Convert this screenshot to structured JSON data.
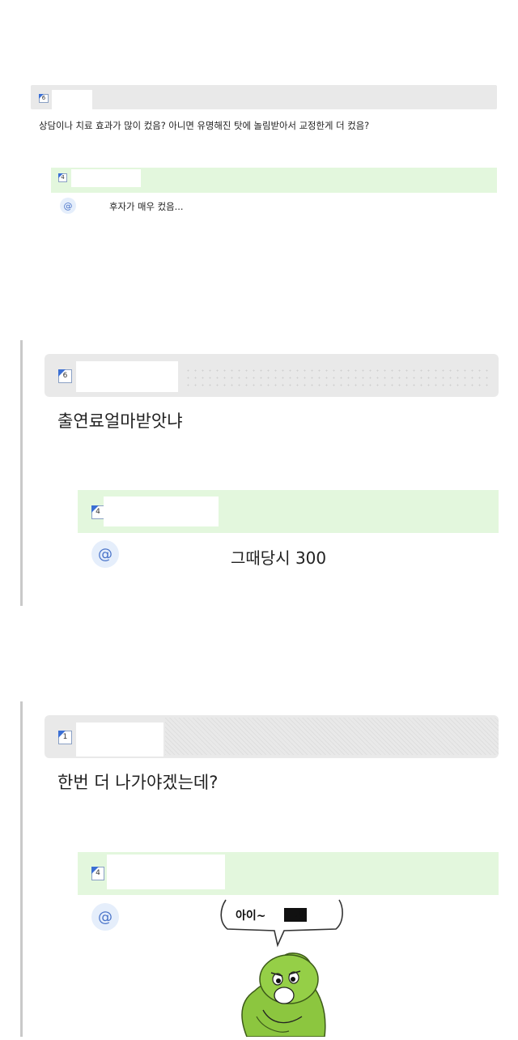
{
  "section1": {
    "comment": {
      "level": "6",
      "text": "상담이나 치료 효과가 많이 컸음? 아니면 유명해진 탓에 놀림받아서 교정한게 더 컸음?"
    },
    "reply": {
      "level": "4",
      "mention_symbol": "@",
      "text": "후자가 매우 컸음..."
    }
  },
  "section2": {
    "comment": {
      "level": "6",
      "text": "출연료얼마받앗냐"
    },
    "reply": {
      "level": "4",
      "mention_symbol": "@",
      "text": "그때당시 300"
    }
  },
  "section3": {
    "comment": {
      "level": "1",
      "text": "한번 더 나가야겠는데?"
    },
    "reply": {
      "level": "4",
      "mention_symbol": "@"
    },
    "image": {
      "speech_text": "아이~",
      "speech_suffix": "!!"
    }
  },
  "colors": {
    "gray_bar": "#e9e9e9",
    "green_bar": "#e3f7dd",
    "accent_blue": "#3b6fd4",
    "character_green": "#8cc63f"
  }
}
